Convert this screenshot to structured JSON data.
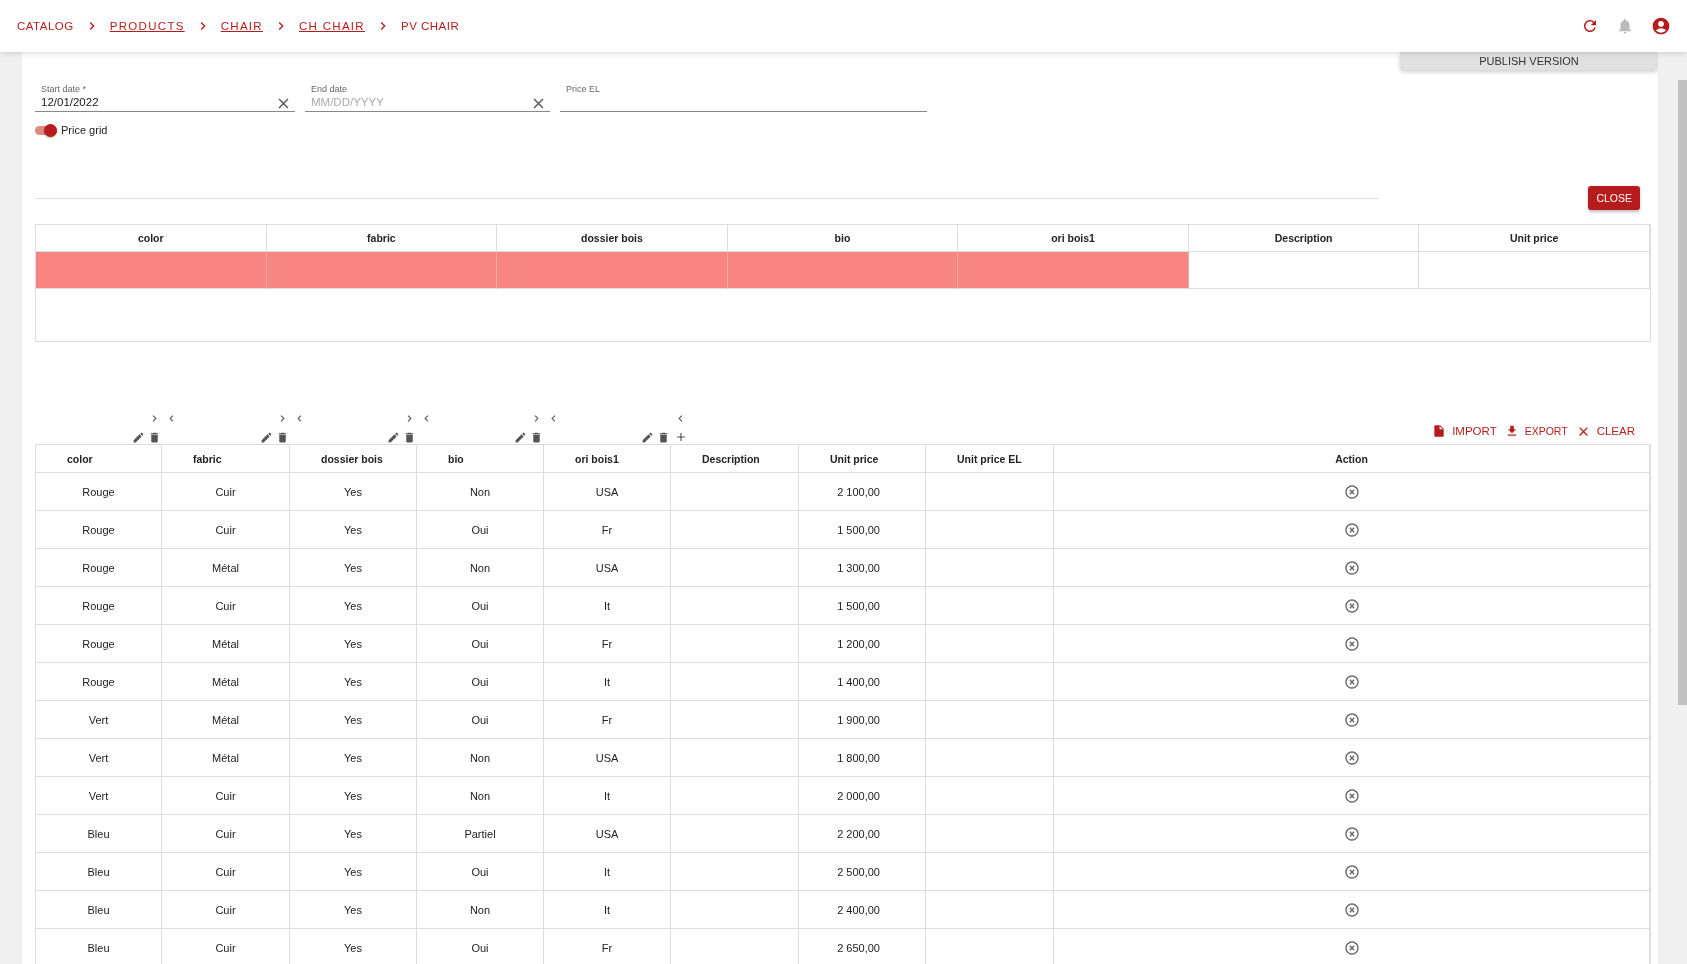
{
  "breadcrumb": [
    {
      "label": "CATALOG",
      "link": false
    },
    {
      "label": "PRODUCTS",
      "link": true
    },
    {
      "label": "CHAIR",
      "link": true
    },
    {
      "label": "CH CHAIR",
      "link": true
    },
    {
      "label": "PV CHAIR",
      "link": false
    }
  ],
  "publish_button": "PUBLISH VERSION",
  "fields": [
    {
      "label": "Start date *",
      "value": "12/01/2022",
      "clearable": true
    },
    {
      "label": "End date",
      "placeholder": "MM/DD/YYYY",
      "clearable": true
    },
    {
      "label": "Price EL",
      "clearable": false
    }
  ],
  "price_grid_toggle": {
    "label": "Price grid",
    "on": true
  },
  "close_button": "CLOSE",
  "filter_table": {
    "columns": [
      "color",
      "fabric",
      "dossier bois",
      "bio",
      "ori bois1",
      "Description",
      "Unit price"
    ],
    "rows": [
      {
        "cells": [
          {
            "highlighted": true
          },
          {
            "highlighted": true
          },
          {
            "highlighted": true
          },
          {
            "highlighted": true
          },
          {
            "highlighted": true
          },
          {
            "highlighted": false
          },
          {
            "highlighted": false
          }
        ]
      }
    ]
  },
  "actions": [
    {
      "kind": "import",
      "label": "IMPORT"
    },
    {
      "kind": "export",
      "label": "EXPORT"
    },
    {
      "kind": "clear",
      "label": "CLEAR"
    }
  ],
  "grid": {
    "columns": [
      {
        "label": "color",
        "kind": "attribute"
      },
      {
        "label": "fabric",
        "kind": "attribute"
      },
      {
        "label": "dossier bois",
        "kind": "attribute"
      },
      {
        "label": "bio",
        "kind": "attribute"
      },
      {
        "label": "ori bois1",
        "kind": "attribute"
      },
      {
        "label": "Description",
        "kind": "description"
      },
      {
        "label": "Unit price",
        "kind": "price"
      },
      {
        "label": "Unit price EL",
        "kind": "price_el"
      },
      {
        "label": "Action",
        "kind": "action"
      }
    ],
    "rows": [
      {
        "attributes": [
          "Rouge",
          "Cuir",
          "Yes",
          "Non",
          "USA"
        ],
        "unit_price": "2 100,00"
      },
      {
        "attributes": [
          "Rouge",
          "Cuir",
          "Yes",
          "Oui",
          "Fr"
        ],
        "unit_price": "1 500,00"
      },
      {
        "attributes": [
          "Rouge",
          "Métal",
          "Yes",
          "Non",
          "USA"
        ],
        "unit_price": "1 300,00"
      },
      {
        "attributes": [
          "Rouge",
          "Cuir",
          "Yes",
          "Oui",
          "It"
        ],
        "unit_price": "1 500,00"
      },
      {
        "attributes": [
          "Rouge",
          "Métal",
          "Yes",
          "Oui",
          "Fr"
        ],
        "unit_price": "1 200,00"
      },
      {
        "attributes": [
          "Rouge",
          "Métal",
          "Yes",
          "Oui",
          "It"
        ],
        "unit_price": "1 400,00"
      },
      {
        "attributes": [
          "Vert",
          "Métal",
          "Yes",
          "Oui",
          "Fr"
        ],
        "unit_price": "1 900,00"
      },
      {
        "attributes": [
          "Vert",
          "Métal",
          "Yes",
          "Non",
          "USA"
        ],
        "unit_price": "1 800,00"
      },
      {
        "attributes": [
          "Vert",
          "Cuir",
          "Yes",
          "Non",
          "It"
        ],
        "unit_price": "2 000,00"
      },
      {
        "attributes": [
          "Bleu",
          "Cuir",
          "Yes",
          "Partiel",
          "USA"
        ],
        "unit_price": "2 200,00"
      },
      {
        "attributes": [
          "Bleu",
          "Cuir",
          "Yes",
          "Oui",
          "It"
        ],
        "unit_price": "2 500,00"
      },
      {
        "attributes": [
          "Bleu",
          "Cuir",
          "Yes",
          "Non",
          "It"
        ],
        "unit_price": "2 400,00"
      },
      {
        "attributes": [
          "Bleu",
          "Cuir",
          "Yes",
          "Oui",
          "Fr"
        ],
        "unit_price": "2 650,00"
      }
    ]
  }
}
